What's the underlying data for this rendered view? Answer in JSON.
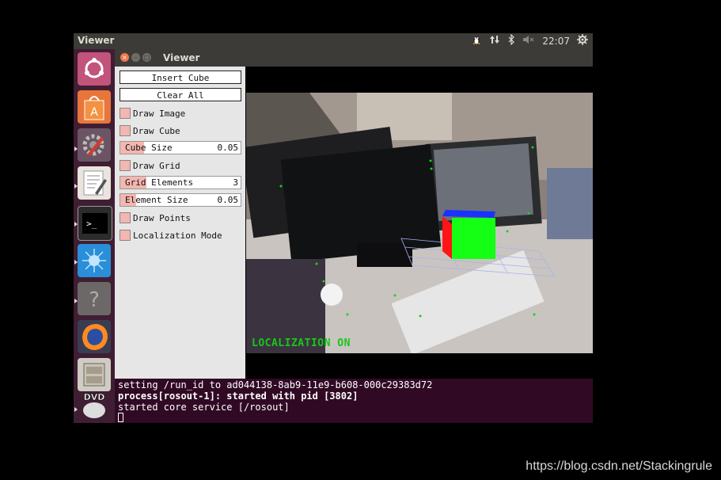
{
  "top_panel": {
    "title": "Viewer",
    "clock": "22:07",
    "icons": [
      "tux-icon",
      "network-icon",
      "bluetooth-icon",
      "volume-muted-icon",
      "settings-gear-icon"
    ]
  },
  "launcher": {
    "items": [
      {
        "name": "ubuntu-dash-icon"
      },
      {
        "name": "software-center-icon"
      },
      {
        "name": "system-settings-icon"
      },
      {
        "name": "text-editor-icon"
      },
      {
        "name": "terminal-icon"
      },
      {
        "name": "app-star-icon"
      },
      {
        "name": "help-icon"
      },
      {
        "name": "firefox-icon"
      },
      {
        "name": "file-cabinet-icon"
      },
      {
        "name": "dvd-icon"
      }
    ],
    "dvd_label": "DVD"
  },
  "window": {
    "title": "Viewer"
  },
  "panel": {
    "insert_cube": "Insert Cube",
    "clear_all": "Clear All",
    "draw_image": "Draw Image",
    "draw_cube": "Draw Cube",
    "cube_size_label": "Cube Size",
    "cube_size_value": "0.05",
    "cube_size_fraction": 0.2,
    "draw_grid": "Draw Grid",
    "grid_elements_label": "Grid Elements",
    "grid_elements_value": "3",
    "grid_elements_fraction": 0.22,
    "element_size_label": "Element Size",
    "element_size_value": "0.05",
    "element_size_fraction": 0.13,
    "draw_points": "Draw Points",
    "localization_mode": "Localization Mode"
  },
  "camera": {
    "overlay_text": "LOCALIZATION ON"
  },
  "terminal": {
    "line1": "setting /run_id to ad044138-8ab9-11e9-b608-000c29383d72",
    "line2": "process[rosout-1]: started with pid [3802]",
    "line3": "started core service [/rosout]"
  },
  "watermark": "https://blog.csdn.net/Stackingrule",
  "colors": {
    "launcher": "#3f1e33",
    "terminal": "#300a24",
    "toggle": "#f4b6b0",
    "overlay_text": "#18c61a"
  }
}
